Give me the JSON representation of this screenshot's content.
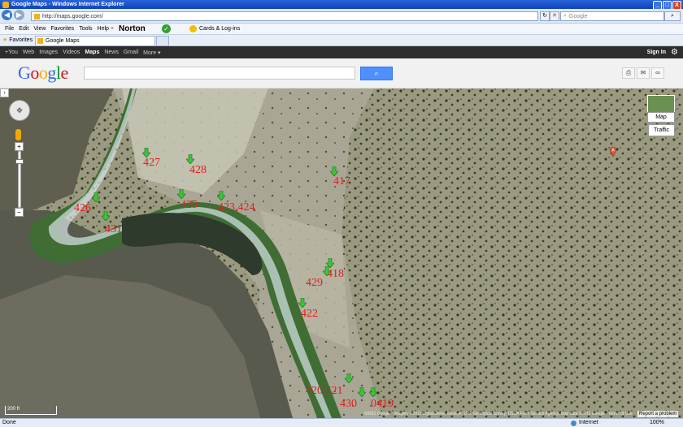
{
  "window": {
    "title": "Google Maps - Windows Internet Explorer",
    "min": "_",
    "max": "□",
    "close": "X"
  },
  "addressbar": {
    "url": "http://maps.google.com/",
    "search_placeholder": "Google",
    "back": "◀",
    "forward": "▶",
    "refresh": "↻",
    "stop": "✕"
  },
  "menu": {
    "items": [
      "File",
      "Edit",
      "View",
      "Favorites",
      "Tools",
      "Help"
    ],
    "norton": "Norton",
    "cards": "Cards & Log-ins"
  },
  "favorites": {
    "label": "Favorites",
    "tab_title": "Google Maps"
  },
  "googlebar": {
    "items": [
      "+You",
      "Web",
      "Images",
      "Videos",
      "Maps",
      "News",
      "Gmail",
      "More ▾"
    ],
    "active": "Maps",
    "signin": "Sign In"
  },
  "header": {
    "logo": "Google"
  },
  "map": {
    "type_button": "Map",
    "traffic_button": "Traffic",
    "scale_label": "200 ft",
    "copyright": "©2011 Google · Imagery ©2011 DigitalGlobe, GeoEye, U.S. Geological Survey, USDA Farm Service Agency, Map data ©2011 Google · Terms of Use",
    "report": "Report a problem",
    "pin_label": "A",
    "markers": [
      {
        "id": "427",
        "label": "427"
      },
      {
        "id": "428",
        "label": "428"
      },
      {
        "id": "417",
        "label": "417"
      },
      {
        "id": "426",
        "label": "426"
      },
      {
        "id": "425",
        "label": "425"
      },
      {
        "id": "423",
        "label": "423,424"
      },
      {
        "id": "431",
        "label": "431"
      },
      {
        "id": "418",
        "label": "418"
      },
      {
        "id": "429",
        "label": "429"
      },
      {
        "id": "422",
        "label": "422"
      },
      {
        "id": "420",
        "label": "420,421"
      },
      {
        "id": "430",
        "label": "430"
      },
      {
        "id": "419",
        "label": "0419"
      }
    ]
  },
  "status": {
    "left": "Done",
    "zone": "Internet",
    "zoom": "100%"
  },
  "colors": {
    "marker_green": "#3ec43a",
    "label_red": "#e31e1e",
    "google_blue": "#4d90fe"
  }
}
